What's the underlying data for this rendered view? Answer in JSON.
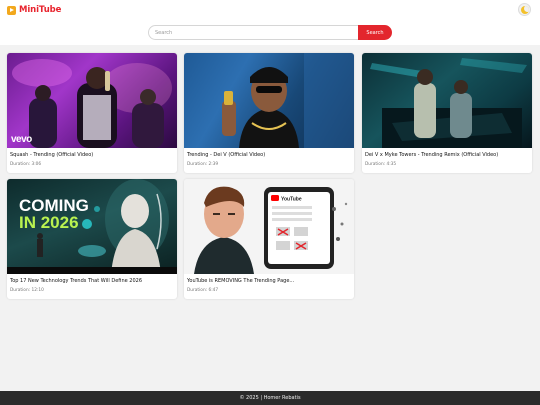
{
  "app": {
    "name": "MiniTube",
    "accent": "#e3262d",
    "logo_color": "#f2a81d"
  },
  "header": {
    "theme_toggle_icon": "moon-icon"
  },
  "search": {
    "placeholder": "Search",
    "value": "",
    "button_label": "Search"
  },
  "videos": [
    {
      "title": "Squash - Trending (Official Video)",
      "duration": "Duration: 3:06",
      "badge": "vevo"
    },
    {
      "title": "Trending - Dei V (Official Video)",
      "duration": "Duration: 2:39"
    },
    {
      "title": "Dei V x Myke Towers - Trending Remix (Official Video)",
      "duration": "Duration: 4:35"
    },
    {
      "title": "Top 17 New Technology Trends That Will Define 2026",
      "duration": "Duration: 12:10",
      "overlay": [
        "COMING",
        "IN 2026"
      ]
    },
    {
      "title": "YouTube is REMOVING The Trending Page...",
      "duration": "Duration: 6:47",
      "overlay_logo": "YouTube"
    }
  ],
  "footer": {
    "text": "© 2025 | Homer Rebatis"
  }
}
